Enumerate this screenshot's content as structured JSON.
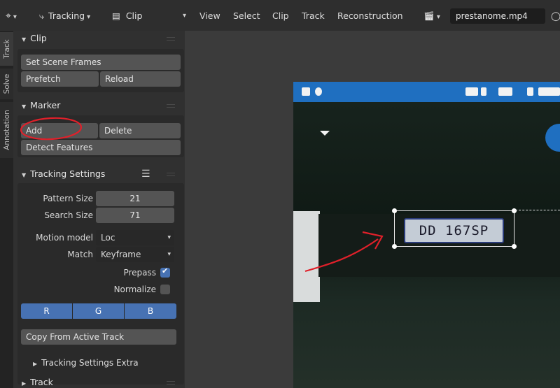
{
  "header": {
    "editor_type": "Tracking",
    "view_type": "Clip",
    "menus": [
      "View",
      "Select",
      "Clip",
      "Track",
      "Reconstruction"
    ],
    "clip_file": "prestanome.mp4"
  },
  "tabs": [
    "Track",
    "Solve",
    "Annotation"
  ],
  "sidebar": {
    "clip": {
      "title": "Clip",
      "set_scene_frames": "Set Scene Frames",
      "prefetch": "Prefetch",
      "reload": "Reload"
    },
    "marker": {
      "title": "Marker",
      "add": "Add",
      "delete": "Delete",
      "detect_features": "Detect Features"
    },
    "tracking_settings": {
      "title": "Tracking Settings",
      "pattern_size_label": "Pattern Size",
      "pattern_size": "21",
      "search_size_label": "Search Size",
      "search_size": "71",
      "motion_model_label": "Motion model",
      "motion_model": "Loc",
      "match_label": "Match",
      "match": "Keyframe",
      "prepass_label": "Prepass",
      "prepass_checked": true,
      "normalize_label": "Normalize",
      "normalize_checked": false,
      "channels": [
        "R",
        "G",
        "B"
      ],
      "copy_from_active": "Copy From Active Track",
      "extra_label": "Tracking Settings Extra"
    },
    "track": {
      "title": "Track"
    }
  },
  "video": {
    "plate_text": "DD 167SP"
  },
  "colors": {
    "accent": "#4772b3",
    "annotation_red": "#e0202a",
    "status_bar_blue": "#1f6fc0"
  }
}
